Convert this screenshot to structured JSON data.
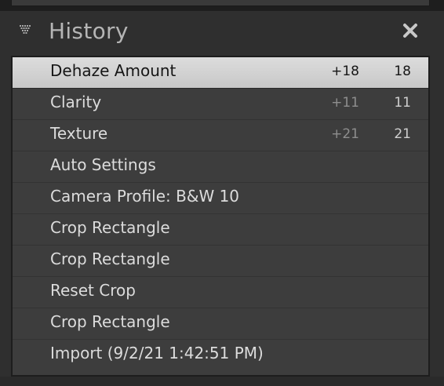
{
  "panel": {
    "title": "History"
  },
  "icons": {
    "collapse": "collapse-triangle-icon",
    "close": "close-x-icon"
  },
  "colors": {
    "selected_row": "#d4d4d4",
    "row_background": "#3d3d3d",
    "panel_background": "#2f2f2f"
  },
  "history": {
    "items": [
      {
        "label": "Dehaze Amount",
        "from": "+18",
        "to": "18",
        "selected": true
      },
      {
        "label": "Clarity",
        "from": "+11",
        "to": "11"
      },
      {
        "label": "Texture",
        "from": "+21",
        "to": "21"
      },
      {
        "label": "Auto Settings",
        "from": "",
        "to": ""
      },
      {
        "label": "Camera Profile: B&W 10",
        "from": "",
        "to": ""
      },
      {
        "label": "Crop Rectangle",
        "from": "",
        "to": ""
      },
      {
        "label": "Crop Rectangle",
        "from": "",
        "to": ""
      },
      {
        "label": "Reset Crop",
        "from": "",
        "to": ""
      },
      {
        "label": "Crop Rectangle",
        "from": "",
        "to": ""
      },
      {
        "label": "Import (9/2/21 1:42:51 PM)",
        "from": "",
        "to": ""
      }
    ]
  }
}
